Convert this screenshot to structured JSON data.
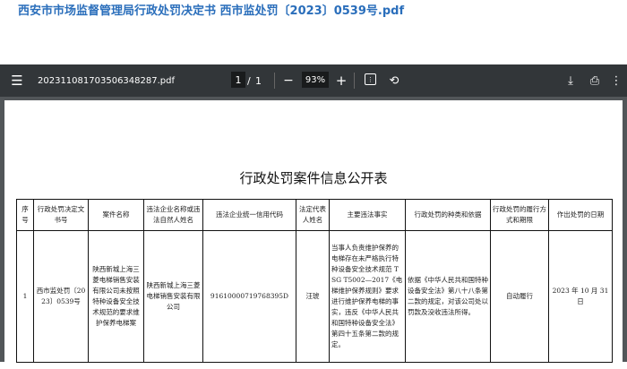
{
  "page_title": "西安市市场监督管理局行政处罚决定书 西市监处罚〔2023〕0539号.pdf",
  "toolbar": {
    "filename": "202311081703506348287.pdf",
    "page_current": "1",
    "page_sep": "/",
    "page_total": "1",
    "zoom": "93%",
    "icons": [
      "menu-icon",
      "zoom-out-icon",
      "zoom-in-icon",
      "fit-page-icon",
      "rotate-icon",
      "download-icon",
      "print-icon",
      "more-icon"
    ]
  },
  "document": {
    "title": "行政处罚案件信息公开表",
    "headers": [
      "序号",
      "行政处罚决定文书号",
      "案件名称",
      "违法企业名称或违法自然人姓名",
      "违法企业统一信用代码",
      "法定代表人姓名",
      "主要违法事实",
      "行政处罚的种类和依据",
      "行政处罚的履行方式和期限",
      "作出处罚的日期"
    ],
    "rows": [
      [
        "1",
        "西市监处罚〔2023〕0539号",
        "陕西新城上海三菱电梯销售安装有限公司未按照特种设备安全技术规范的要求维护保养电梯案",
        "陕西新城上海三菱电梯销售安装有限公司",
        "91610000719768395D",
        "汪琥",
        "当事人负责维护保养的电梯存在未严格执行特种设备安全技术规范 TSG T5002—2017《电梯维护保养规则》要求进行维护保养电梯的事实，违反《中华人民共和国特种设备安全法》第四十五条第二款的规定。",
        "依据《中华人民共和国特种设备安全法》第八十八条第二款的规定，对该公司处以罚款及没收违法所得。",
        "自动履行",
        "2023 年 10 月 31 日"
      ]
    ]
  }
}
